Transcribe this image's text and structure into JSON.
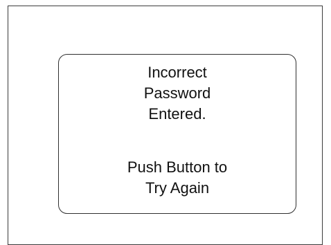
{
  "dialog": {
    "error_lines": [
      "Incorrect",
      "Password",
      "Entered."
    ],
    "instruction_lines": [
      "Push Button to",
      "Try Again"
    ]
  }
}
